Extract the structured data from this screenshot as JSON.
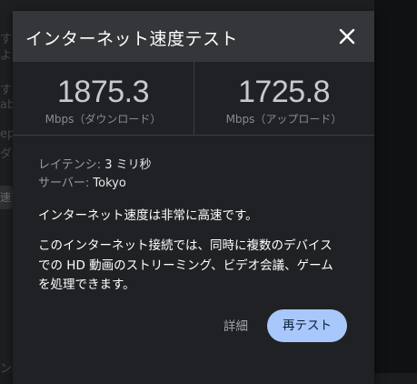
{
  "dialog": {
    "title": "インターネット速度テスト"
  },
  "download": {
    "value": "1875.3",
    "unit": "Mbps（ダウンロード）"
  },
  "upload": {
    "value": "1725.8",
    "unit": "Mbps（アップロード）"
  },
  "latency": {
    "label": "レイテンシ:",
    "value": "3 ミリ秒"
  },
  "server": {
    "label": "サーバー:",
    "value": "Tokyo"
  },
  "summary": "インターネット速度は非常に高速です。",
  "description": [
    "このインターネット接続では、同時に複数のデバイス",
    "での HD 動画のストリーミング、ビデオ会議、ゲーム",
    "を処理できます。"
  ],
  "actions": {
    "details_label": "詳細",
    "retest_label": "再テスト"
  },
  "background": {
    "fragments": [
      "す速",
      "より",
      "す",
      "ab",
      "ep",
      "ダ",
      "速",
      "ン"
    ]
  },
  "colors": {
    "header_bg": "#35363a",
    "dialog_bg": "#202124",
    "accent_button": "#a8c7fa"
  },
  "icons": {
    "close": "close-icon"
  }
}
